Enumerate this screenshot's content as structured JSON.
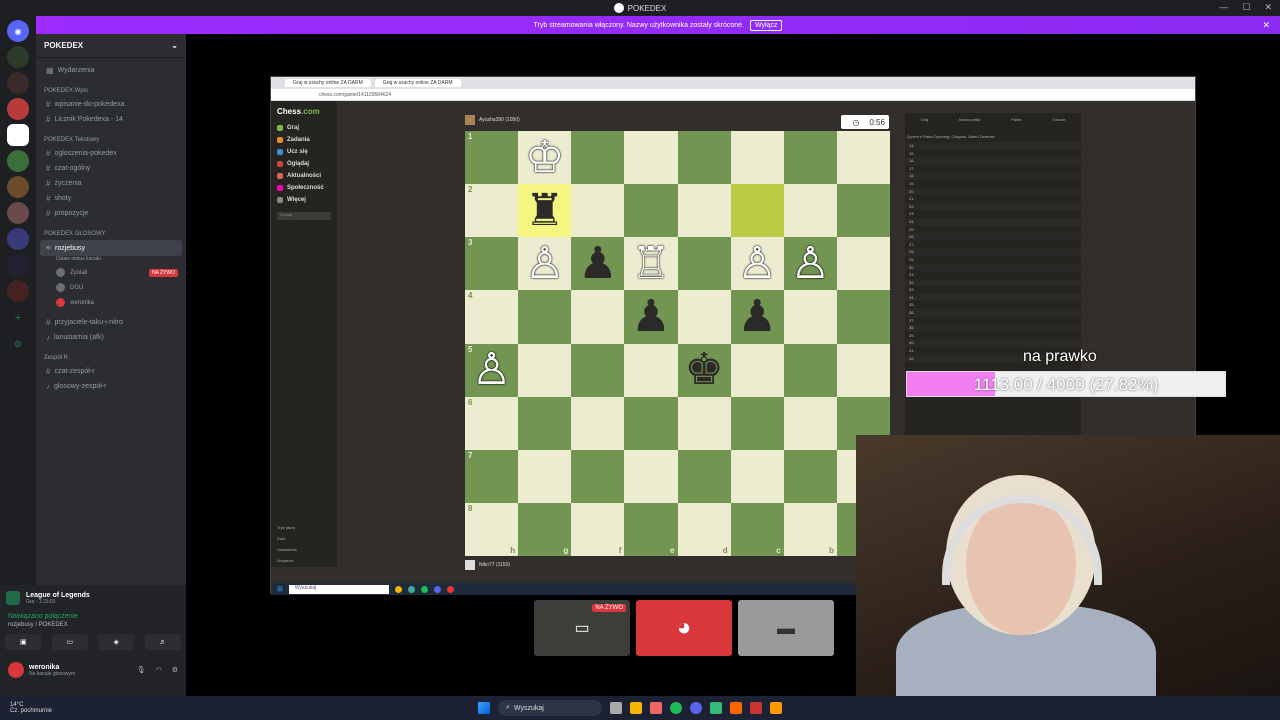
{
  "window": {
    "title": "POKEDEX",
    "controls": [
      "—",
      "☐",
      "✕"
    ]
  },
  "banner": {
    "text": "Tryb streamowania włączony. Nazwy użytkownika zostały skrócone.",
    "button": "Wyłącz"
  },
  "guilds": [
    "",
    ""
  ],
  "sidebar": {
    "server_name": "POKEDEX",
    "events": "Wydarzenia",
    "cat1": "POKEDEX Wpis",
    "cat1_channels": [
      "wpisanie-do-pokedexa",
      "Licznik Pokedexa - 14"
    ],
    "cat2": "POKEDEX Tekstowy",
    "cat2_channels": [
      "ogloszenia-pokedex",
      "czat-ogólny",
      "życzenia",
      "shoty",
      "propozycje"
    ],
    "cat3": "POKEDEX GŁOSOWY",
    "voice_channel": "rozjebusy",
    "voice_status": "Ustaw status kanału",
    "voice_users": [
      "Zyolali",
      "DGU",
      "weronika"
    ],
    "live_badge": "NA ŻYWO",
    "more_channels": [
      "przyjaciele-taku-i-nitro",
      "lanusiarnia (afk)"
    ],
    "cat4": "Zespół R",
    "cat4_channels": [
      "czat-zespół-r",
      "glosowy-zespół-r"
    ]
  },
  "voicebox": {
    "game": "League of Legends",
    "game_time": "Gra - 1:23:01",
    "connected": "Nawiązano połączenie",
    "channel": "rozjebusy / POKEDEX",
    "username": "weronika",
    "user_status": "Na kanale głosowym"
  },
  "browser": {
    "tabs": [
      "Graj w szachy online ZA DARM",
      "Graj w szachy online ZA DARM"
    ],
    "url": "chess.com/game/141139664624"
  },
  "chess_nav": {
    "logo_a": "Chess",
    "logo_b": ".com",
    "items": [
      "Graj",
      "Zadania",
      "Ucz się",
      "Oglądaj",
      "Aktualności",
      "Społeczność",
      "Więcej"
    ],
    "search": "Szukaj",
    "bottom": [
      "Tryb jasny",
      "Zwiń",
      "Ustawienia",
      "Wsparcie"
    ]
  },
  "game": {
    "top_player": "Ayusha390 (1050)",
    "bottom_player": "Niko77 (1150)",
    "clock": "0:56",
    "ranks": [
      "1",
      "2",
      "3",
      "4",
      "5",
      "6",
      "7",
      "8"
    ],
    "files": [
      "h",
      "g",
      "f",
      "e",
      "d",
      "c",
      "b"
    ],
    "pieces": [
      {
        "sq": "g1",
        "p": "♔",
        "c": "w"
      },
      {
        "sq": "g2",
        "p": "♜",
        "c": "b"
      },
      {
        "sq": "g3",
        "p": "♙",
        "c": "w"
      },
      {
        "sq": "f3",
        "p": "♟",
        "c": "b"
      },
      {
        "sq": "e3",
        "p": "♖",
        "c": "w"
      },
      {
        "sq": "c3",
        "p": "♙",
        "c": "w"
      },
      {
        "sq": "b3",
        "p": "♙",
        "c": "w"
      },
      {
        "sq": "e4",
        "p": "♟",
        "c": "b"
      },
      {
        "sq": "c4",
        "p": "♟",
        "c": "b"
      },
      {
        "sq": "h5",
        "p": "♙",
        "c": "w"
      },
      {
        "sq": "d5",
        "p": "♚",
        "c": "b"
      }
    ],
    "highlight": [
      "g2",
      "c2"
    ]
  },
  "move_panel": {
    "tabs": [
      "Graj",
      "Nowa partia",
      "Partie",
      "Gracze"
    ],
    "opening": "Queen's Pawn Opening: Chigorin, Albert Defense",
    "moves": [
      "14.",
      "15.",
      "16.",
      "17.",
      "18.",
      "19.",
      "20.",
      "21.",
      "22.",
      "23.",
      "24.",
      "25.",
      "26.",
      "27.",
      "28.",
      "29.",
      "30.",
      "31.",
      "32.",
      "33.",
      "34.",
      "35.",
      "36.",
      "37.",
      "38.",
      "39.",
      "40.",
      "41.",
      "42."
    ]
  },
  "taskbar_inner": {
    "search": "Wyszukaj"
  },
  "overlay": {
    "title": "na prawko",
    "progress_text": "1113.00 / 4000 (27.82%)",
    "progress_fraction": 0.2782
  },
  "streams": {
    "live_badge": "NA ŻYWO"
  },
  "taskbar": {
    "weather_temp": "14°C",
    "weather_desc": "Cz. pochmurnie",
    "search": "Wyszukaj"
  }
}
